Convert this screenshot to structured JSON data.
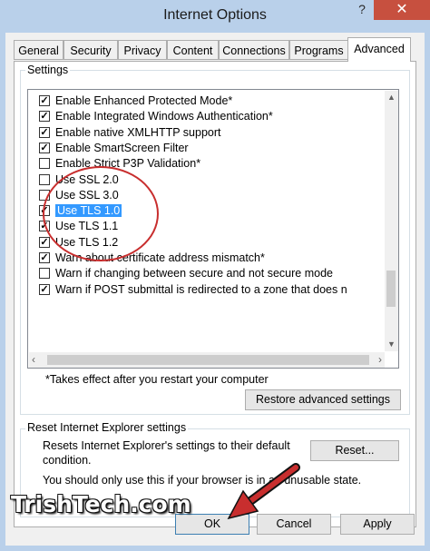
{
  "window": {
    "title": "Internet Options",
    "help_glyph": "?",
    "close_glyph": "✕"
  },
  "tabs": [
    {
      "label": "General"
    },
    {
      "label": "Security"
    },
    {
      "label": "Privacy"
    },
    {
      "label": "Content"
    },
    {
      "label": "Connections"
    },
    {
      "label": "Programs"
    },
    {
      "label": "Advanced",
      "active": true
    }
  ],
  "settings": {
    "group_label": "Settings",
    "items": [
      {
        "label": "Enable Enhanced Protected Mode*",
        "checked": true
      },
      {
        "label": "Enable Integrated Windows Authentication*",
        "checked": true
      },
      {
        "label": "Enable native XMLHTTP support",
        "checked": true
      },
      {
        "label": "Enable SmartScreen Filter",
        "checked": true
      },
      {
        "label": "Enable Strict P3P Validation*",
        "checked": false
      },
      {
        "label": "Use SSL 2.0",
        "checked": false
      },
      {
        "label": "Use SSL 3.0",
        "checked": false
      },
      {
        "label": "Use TLS 1.0",
        "checked": true,
        "selected": true
      },
      {
        "label": "Use TLS 1.1",
        "checked": true
      },
      {
        "label": "Use TLS 1.2",
        "checked": true
      },
      {
        "label": "Warn about certificate address mismatch*",
        "checked": true
      },
      {
        "label": "Warn if changing between secure and not secure mode",
        "checked": false
      },
      {
        "label": "Warn if POST submittal is redirected to a zone that does n",
        "checked": true
      }
    ],
    "note": "*Takes effect after you restart your computer",
    "restore_button": "Restore advanced settings"
  },
  "reset": {
    "group_label": "Reset Internet Explorer settings",
    "description_line1": "Resets Internet Explorer's settings to their default",
    "description_line2": "condition.",
    "reset_button": "Reset...",
    "warning": "You should only use this if your browser is in an unusable state."
  },
  "footer": {
    "ok": "OK",
    "cancel": "Cancel",
    "apply": "Apply"
  },
  "watermark": "TrishTech.com",
  "colors": {
    "annotation": "#c82e2e",
    "selection": "#3399ff",
    "titlebar": "#b9d0ea"
  }
}
